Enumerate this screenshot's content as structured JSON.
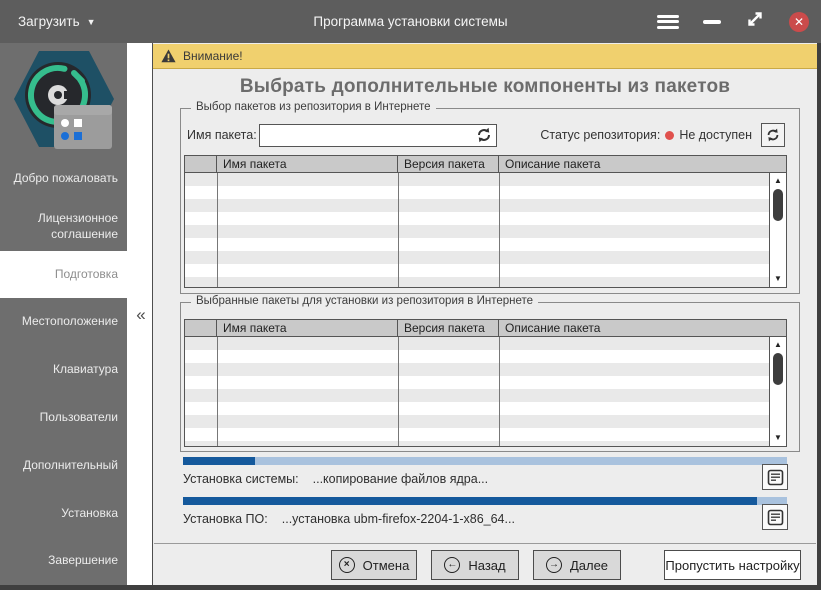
{
  "titlebar": {
    "load_button": "Загрузить",
    "title": "Программа установки системы"
  },
  "icons": {
    "dropdown_caret": "▼",
    "collapse_chevron": "«",
    "scroll_up": "▲",
    "scroll_down": "▼",
    "cancel_glyph": "×",
    "back_glyph": "←",
    "next_glyph": "→"
  },
  "sidebar": {
    "items": [
      {
        "label": "Добро пожаловать",
        "selected": false
      },
      {
        "label": "Лицензионное соглашение",
        "selected": false
      },
      {
        "label": "Подготовка",
        "selected": true
      },
      {
        "label": "Местоположение",
        "selected": false
      },
      {
        "label": "Клавиатура",
        "selected": false
      },
      {
        "label": "Пользователи",
        "selected": false
      },
      {
        "label": "Дополнительный",
        "selected": false
      },
      {
        "label": "Установка",
        "selected": false
      },
      {
        "label": "Завершение",
        "selected": false
      }
    ]
  },
  "banner": {
    "text": "Внимание!"
  },
  "main": {
    "title": "Выбрать дополнительные компоненты из пакетов",
    "repo_group": {
      "legend": "Выбор пакетов из репозитория в Интернете",
      "package_name_label": "Имя пакета:",
      "package_name_value": "",
      "status_label": "Статус репозитория:",
      "status_value": "Не доступен",
      "status_color": "#e0514d",
      "table": {
        "columns": [
          "",
          "Имя пакета",
          "Версия пакета",
          "Описание пакета"
        ],
        "rows": []
      }
    },
    "selected_group": {
      "legend": "Выбранные пакеты для установки из репозитория в Интернете",
      "table": {
        "columns": [
          "",
          "Имя пакета",
          "Версия пакета",
          "Описание пакета"
        ],
        "rows": []
      }
    },
    "progress": [
      {
        "label": "Установка системы:",
        "status": "...копирование файлов ядра...",
        "percent": 12
      },
      {
        "label": "Установка ПО:",
        "status": "...установка ubm-firefox-2204-1-x86_64...",
        "percent": 95
      }
    ]
  },
  "footer": {
    "cancel": "Отмена",
    "back": "Назад",
    "next": "Далее",
    "skip": "Пропустить настройку"
  },
  "colors": {
    "titlebar_bg": "#5d5d5d",
    "sidebar_bg": "#6e6e6e",
    "content_bg": "#ededed",
    "warning_bg": "#f0d06e",
    "progress_fill": "#15599c",
    "progress_track": "#a9c2de",
    "close_button": "#cb4b4b"
  }
}
